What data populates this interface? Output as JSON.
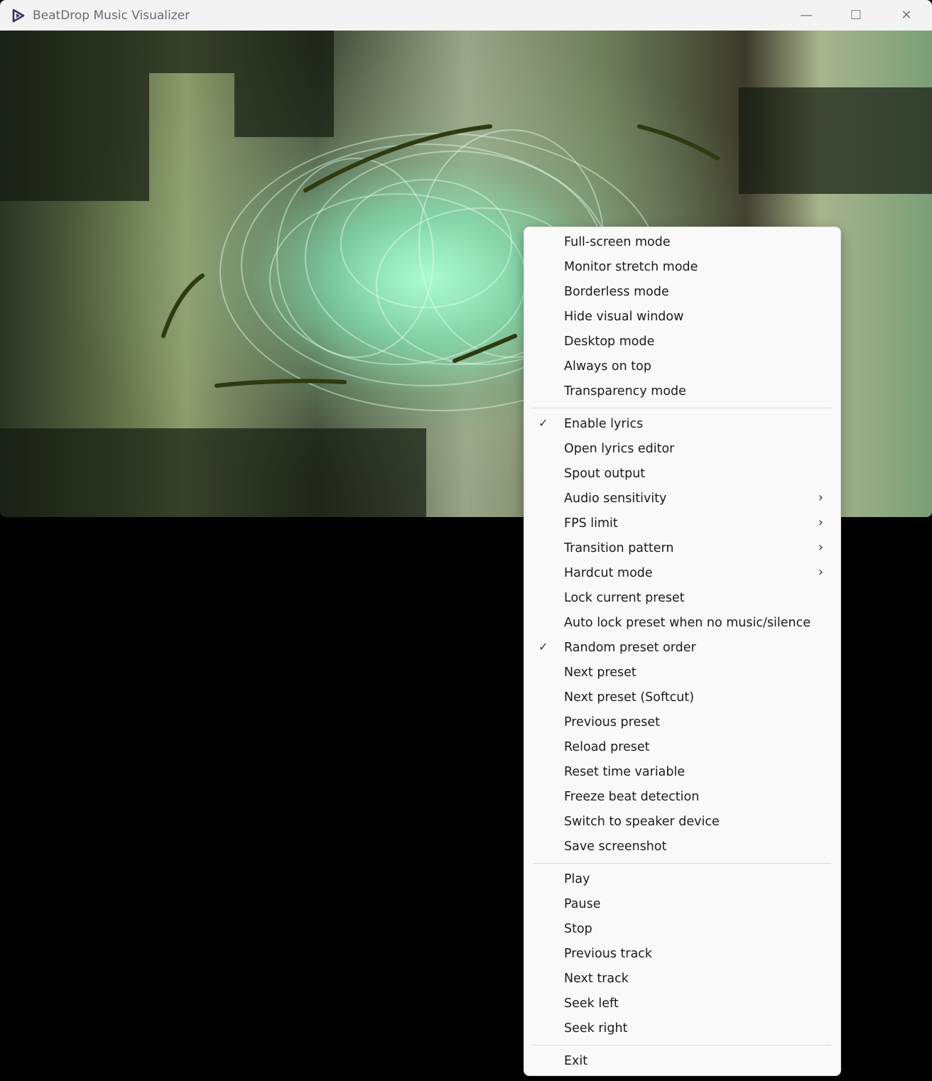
{
  "window": {
    "title": "BeatDrop Music Visualizer",
    "controls": {
      "minimize": "—",
      "maximize": "☐",
      "close": "✕"
    }
  },
  "menu": {
    "groups": [
      [
        {
          "label": "Full-screen mode",
          "checked": false,
          "submenu": false
        },
        {
          "label": "Monitor stretch mode",
          "checked": false,
          "submenu": false
        },
        {
          "label": "Borderless mode",
          "checked": false,
          "submenu": false
        },
        {
          "label": "Hide visual window",
          "checked": false,
          "submenu": false
        },
        {
          "label": "Desktop mode",
          "checked": false,
          "submenu": false
        },
        {
          "label": "Always on top",
          "checked": false,
          "submenu": false
        },
        {
          "label": "Transparency mode",
          "checked": false,
          "submenu": false
        }
      ],
      [
        {
          "label": "Enable lyrics",
          "checked": true,
          "submenu": false
        },
        {
          "label": "Open lyrics editor",
          "checked": false,
          "submenu": false
        },
        {
          "label": "Spout output",
          "checked": false,
          "submenu": false
        },
        {
          "label": "Audio sensitivity",
          "checked": false,
          "submenu": true
        },
        {
          "label": "FPS limit",
          "checked": false,
          "submenu": true
        },
        {
          "label": "Transition pattern",
          "checked": false,
          "submenu": true
        },
        {
          "label": "Hardcut mode",
          "checked": false,
          "submenu": true
        },
        {
          "label": "Lock current preset",
          "checked": false,
          "submenu": false
        },
        {
          "label": "Auto lock preset when no music/silence",
          "checked": false,
          "submenu": false
        },
        {
          "label": "Random preset order",
          "checked": true,
          "submenu": false
        },
        {
          "label": "Next preset",
          "checked": false,
          "submenu": false
        },
        {
          "label": "Next preset (Softcut)",
          "checked": false,
          "submenu": false
        },
        {
          "label": "Previous preset",
          "checked": false,
          "submenu": false
        },
        {
          "label": "Reload preset",
          "checked": false,
          "submenu": false
        },
        {
          "label": "Reset time variable",
          "checked": false,
          "submenu": false
        },
        {
          "label": "Freeze beat detection",
          "checked": false,
          "submenu": false
        },
        {
          "label": "Switch to speaker device",
          "checked": false,
          "submenu": false
        },
        {
          "label": "Save screenshot",
          "checked": false,
          "submenu": false
        }
      ],
      [
        {
          "label": "Play",
          "checked": false,
          "submenu": false
        },
        {
          "label": "Pause",
          "checked": false,
          "submenu": false
        },
        {
          "label": "Stop",
          "checked": false,
          "submenu": false
        },
        {
          "label": "Previous track",
          "checked": false,
          "submenu": false
        },
        {
          "label": "Next track",
          "checked": false,
          "submenu": false
        },
        {
          "label": "Seek left",
          "checked": false,
          "submenu": false
        },
        {
          "label": "Seek right",
          "checked": false,
          "submenu": false
        }
      ],
      [
        {
          "label": "Exit",
          "checked": false,
          "submenu": false
        }
      ]
    ],
    "check_glyph": "✓",
    "submenu_glyph": "›"
  },
  "colors": {
    "menu_bg": "#f9f9f9",
    "titlebar_bg": "#f3f3f3",
    "glow": "#a8ffd0"
  }
}
